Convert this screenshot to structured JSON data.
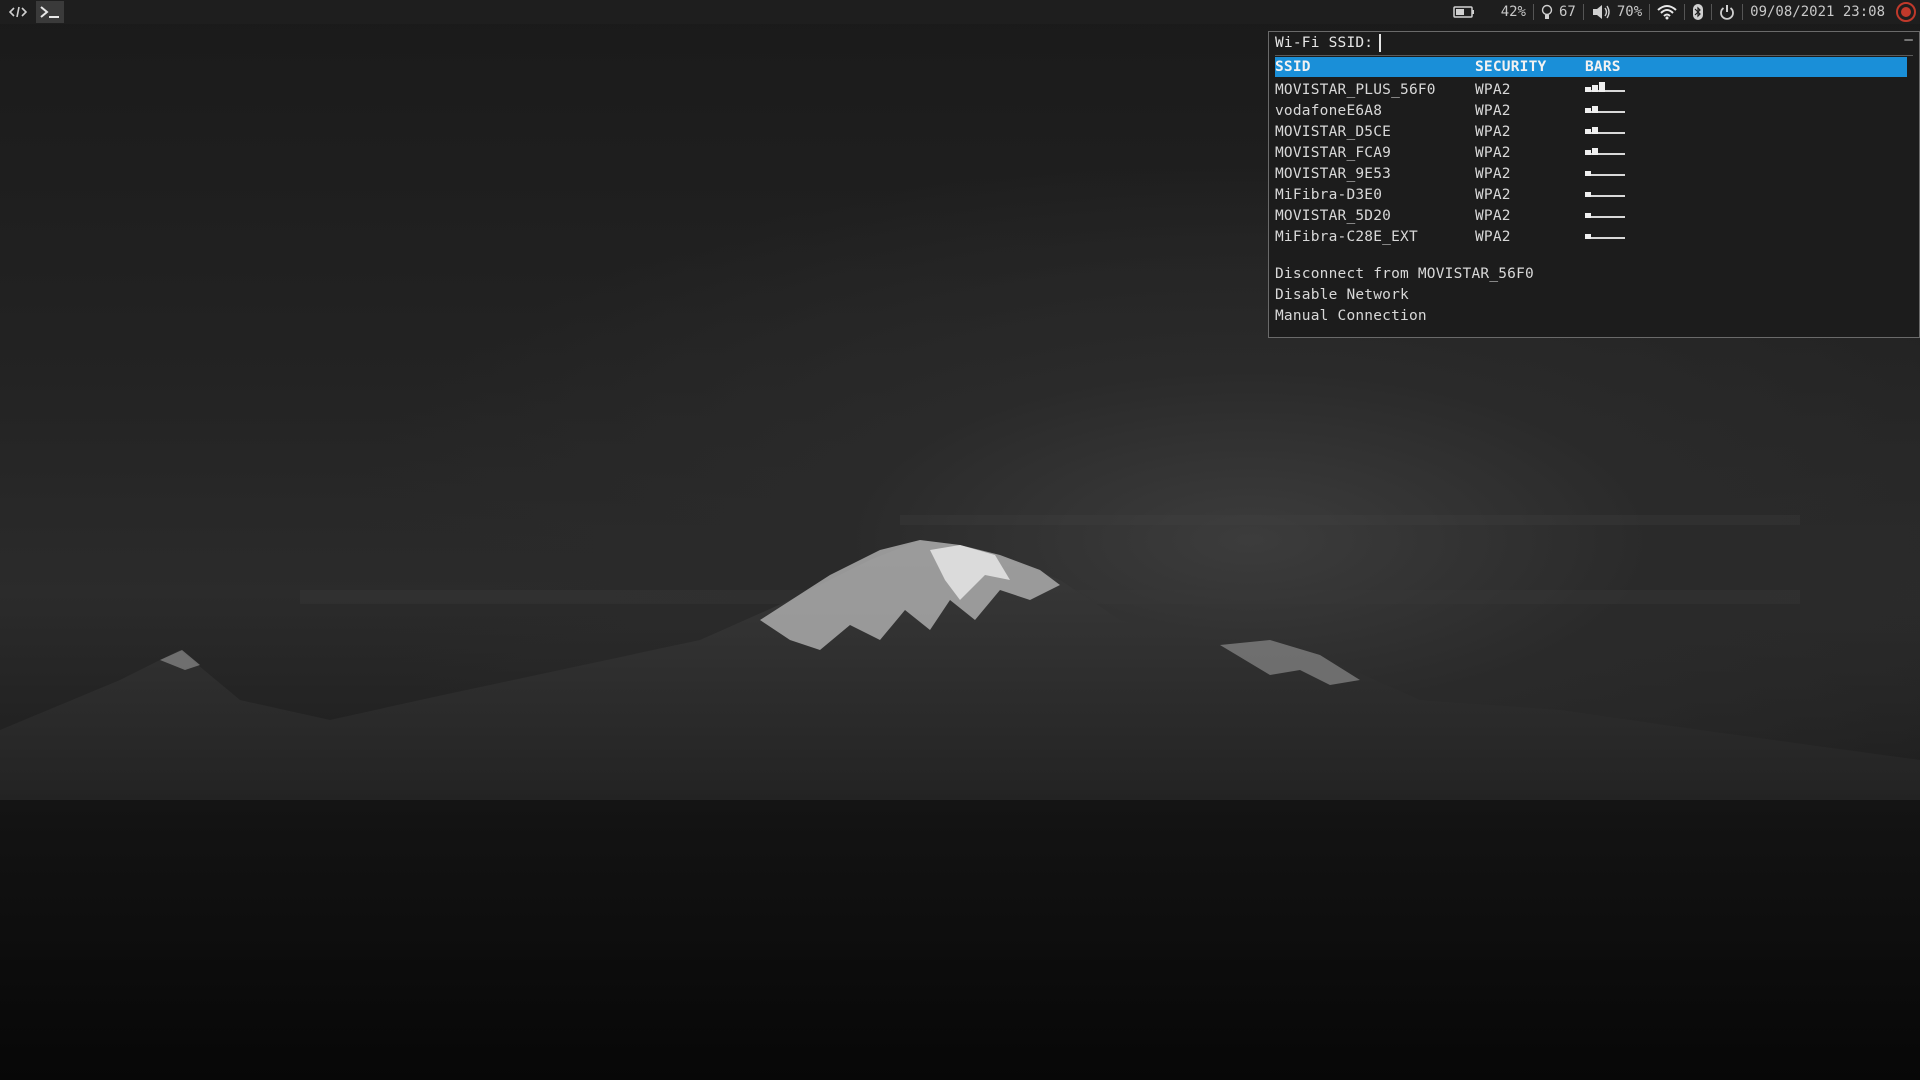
{
  "topbar": {
    "left": [
      {
        "icon": "code-icon"
      },
      {
        "icon": "terminal-icon"
      }
    ],
    "battery": {
      "icon": "battery-icon",
      "value": "42%"
    },
    "brightness": {
      "icon": "lightbulb-icon",
      "value": "67"
    },
    "volume": {
      "icon": "speaker-icon",
      "value": "70%"
    },
    "wifi": {
      "icon": "wifi-icon"
    },
    "bluetooth": {
      "icon": "bluetooth-icon"
    },
    "power": {
      "icon": "power-icon"
    },
    "datetime": "09/08/2021 23:08"
  },
  "wifi_menu": {
    "prompt": "Wi-Fi SSID:",
    "input_value": "",
    "close_label": "–",
    "headers": {
      "ssid": "SSID",
      "security": "SECURITY",
      "bars": "BARS"
    },
    "networks": [
      {
        "ssid": "MOVISTAR_PLUS_56F0",
        "security": "WPA2",
        "bars": 3
      },
      {
        "ssid": "vodafoneE6A8",
        "security": "WPA2",
        "bars": 2
      },
      {
        "ssid": "MOVISTAR_D5CE",
        "security": "WPA2",
        "bars": 2
      },
      {
        "ssid": "MOVISTAR_FCA9",
        "security": "WPA2",
        "bars": 2
      },
      {
        "ssid": "MOVISTAR_9E53",
        "security": "WPA2",
        "bars": 1
      },
      {
        "ssid": "MiFibra-D3E0",
        "security": "WPA2",
        "bars": 1
      },
      {
        "ssid": "MOVISTAR_5D20",
        "security": "WPA2",
        "bars": 1
      },
      {
        "ssid": "MiFibra-C28E_EXT",
        "security": "WPA2",
        "bars": 1
      }
    ],
    "actions": [
      "Disconnect from MOVISTAR_56F0",
      "Disable Network",
      "Manual Connection"
    ]
  },
  "colors": {
    "selection": "#1a8fd8",
    "bar_bg": "#1e1e1e",
    "menu_bg": "#1c1c1c"
  }
}
